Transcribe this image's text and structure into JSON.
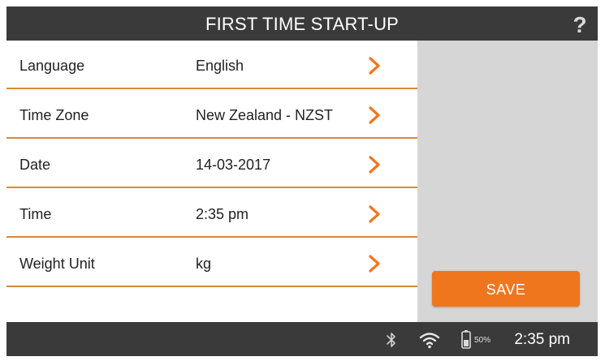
{
  "header": {
    "title": "FIRST TIME START-UP",
    "help_glyph": "?"
  },
  "settings": [
    {
      "label": "Language",
      "value": "English"
    },
    {
      "label": "Time Zone",
      "value": "New Zealand - NZST"
    },
    {
      "label": "Date",
      "value": "14-03-2017"
    },
    {
      "label": "Time",
      "value": "2:35 pm"
    },
    {
      "label": "Weight Unit",
      "value": "kg"
    }
  ],
  "actions": {
    "save_label": "SAVE"
  },
  "statusbar": {
    "battery_percent": "50%",
    "clock": "2:35 pm",
    "icons": [
      "bluetooth-icon",
      "wifi-icon",
      "battery-icon"
    ]
  },
  "colors": {
    "accent": "#f0761e",
    "divider": "#d9893a",
    "bar_background": "#3a3a3a",
    "side_panel": "#d6d6d6"
  }
}
